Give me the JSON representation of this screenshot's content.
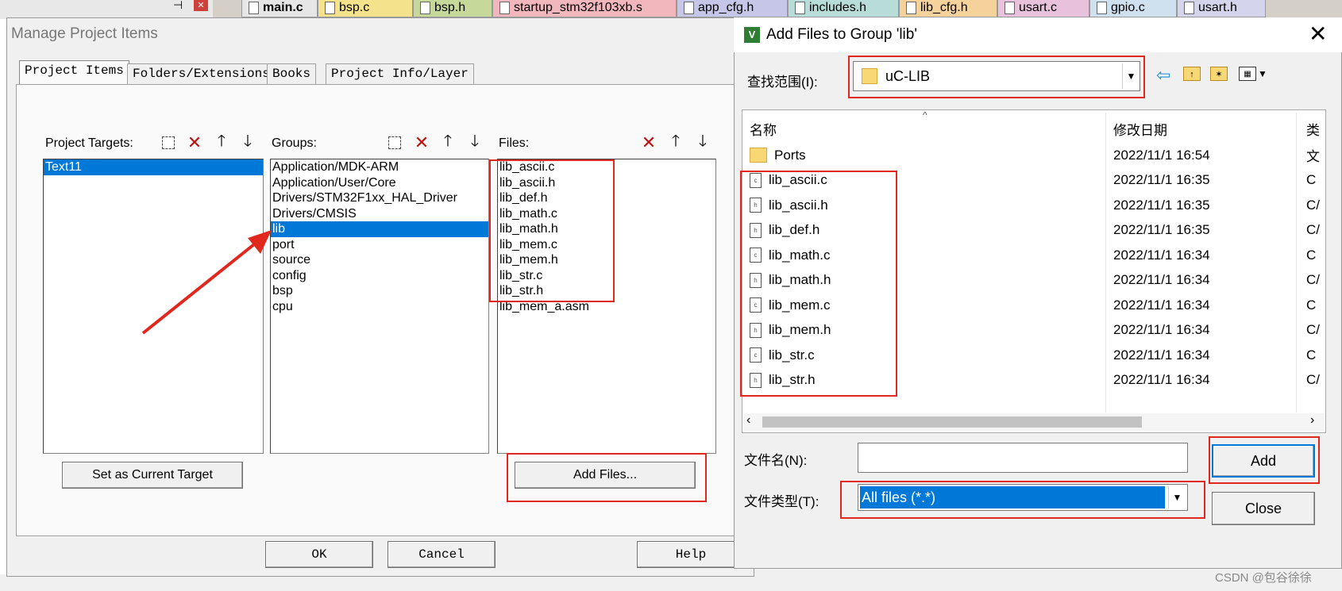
{
  "editor_tabs": [
    {
      "label": "main.c",
      "color": "#e6e6e6"
    },
    {
      "label": "bsp.c",
      "color": "#f5e28c"
    },
    {
      "label": "bsp.h",
      "color": "#c7d99a"
    },
    {
      "label": "startup_stm32f103xb.s",
      "color": "#f2b7bd"
    },
    {
      "label": "app_cfg.h",
      "color": "#c6c6e8"
    },
    {
      "label": "includes.h",
      "color": "#b8dcd8"
    },
    {
      "label": "lib_cfg.h",
      "color": "#f5d29c"
    },
    {
      "label": "usart.c",
      "color": "#e8c2dc"
    },
    {
      "label": "gpio.c",
      "color": "#cfe0ee"
    },
    {
      "label": "usart.h",
      "color": "#d4d4ec"
    }
  ],
  "manage": {
    "title": "Manage Project Items",
    "tabs": [
      "Project Items",
      "Folders/Extensions",
      "Books",
      "Project Info/Layer"
    ],
    "targets_label": "Project Targets:",
    "targets": [
      "Text11"
    ],
    "groups_label": "Groups:",
    "groups": [
      "Application/MDK-ARM",
      "Application/User/Core",
      "Drivers/STM32F1xx_HAL_Driver",
      "Drivers/CMSIS",
      "lib",
      "port",
      "source",
      "config",
      "bsp",
      "cpu"
    ],
    "selected_group": "lib",
    "files_label": "Files:",
    "files": [
      "lib_ascii.c",
      "lib_ascii.h",
      "lib_def.h",
      "lib_math.c",
      "lib_math.h",
      "lib_mem.c",
      "lib_mem.h",
      "lib_str.c",
      "lib_str.h",
      "lib_mem_a.asm"
    ],
    "set_target_button": "Set as Current Target",
    "add_files_button": "Add Files...",
    "ok_button": "OK",
    "cancel_button": "Cancel",
    "help_button": "Help"
  },
  "addfiles": {
    "title": "Add Files to Group 'lib'",
    "look_in_label": "查找范围(I):",
    "look_in_value": "uC-LIB",
    "col_name": "名称",
    "col_date": "修改日期",
    "col_type": "类",
    "rows": [
      {
        "name": "Ports",
        "date": "2022/11/1 16:54",
        "type": "文",
        "kind": "folder"
      },
      {
        "name": "lib_ascii.c",
        "date": "2022/11/1 16:35",
        "type": "C",
        "kind": "c"
      },
      {
        "name": "lib_ascii.h",
        "date": "2022/11/1 16:35",
        "type": "C/",
        "kind": "h"
      },
      {
        "name": "lib_def.h",
        "date": "2022/11/1 16:35",
        "type": "C/",
        "kind": "h"
      },
      {
        "name": "lib_math.c",
        "date": "2022/11/1 16:34",
        "type": "C",
        "kind": "c"
      },
      {
        "name": "lib_math.h",
        "date": "2022/11/1 16:34",
        "type": "C/",
        "kind": "h"
      },
      {
        "name": "lib_mem.c",
        "date": "2022/11/1 16:34",
        "type": "C",
        "kind": "c"
      },
      {
        "name": "lib_mem.h",
        "date": "2022/11/1 16:34",
        "type": "C/",
        "kind": "h"
      },
      {
        "name": "lib_str.c",
        "date": "2022/11/1 16:34",
        "type": "C",
        "kind": "c"
      },
      {
        "name": "lib_str.h",
        "date": "2022/11/1 16:34",
        "type": "C/",
        "kind": "h"
      }
    ],
    "filename_label": "文件名(N):",
    "filename_value": "",
    "filetype_label": "文件类型(T):",
    "filetype_value": "All files (*.*)",
    "add_button": "Add",
    "close_button": "Close"
  },
  "watermark": "CSDN @包谷徐徐",
  "colors": {
    "highlight": "#0078d7",
    "annotation": "#e0281e"
  }
}
